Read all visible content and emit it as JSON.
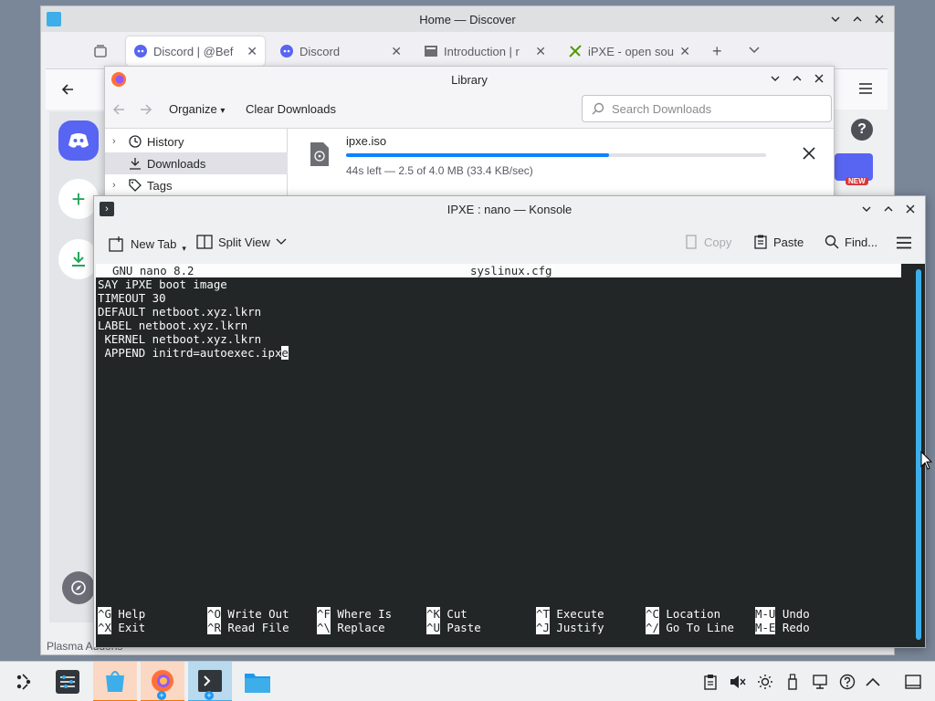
{
  "discover": {
    "title": "Home — Discover",
    "footer_label": "Plasma Addons"
  },
  "firefox": {
    "tabs": [
      {
        "label": "Discord | @Bef"
      },
      {
        "label": "Discord"
      },
      {
        "label": "Introduction | r"
      },
      {
        "label": "iPXE - open sou"
      }
    ]
  },
  "library": {
    "title": "Library",
    "organize_label": "Organize",
    "clear_downloads_label": "Clear Downloads",
    "search_placeholder": "Search Downloads",
    "sidebar": [
      {
        "label": "History"
      },
      {
        "label": "Downloads"
      },
      {
        "label": "Tags"
      }
    ],
    "download": {
      "filename": "ipxe.iso",
      "status": "44s left — 2.5 of 4.0 MB (33.4 KB/sec)",
      "progress": 0.625
    }
  },
  "konsole": {
    "title": "IPXE : nano — Konsole",
    "toolbar": {
      "new_tab": "New Tab",
      "split_view": "Split View",
      "copy": "Copy",
      "paste": "Paste",
      "find": "Find..."
    }
  },
  "nano": {
    "version": "GNU nano 8.2",
    "filename": "syslinux.cfg",
    "lines": [
      "SAY iPXE boot image",
      "TIMEOUT 30",
      "DEFAULT netboot.xyz.lkrn",
      "LABEL netboot.xyz.lkrn",
      " KERNEL netboot.xyz.lkrn"
    ],
    "last_line_before_cursor": " APPEND initrd=autoexec.ipx",
    "cursor_char": "e",
    "shortcuts": [
      {
        "k1": "^G",
        "l1": "Help",
        "k2": "^X",
        "l2": "Exit"
      },
      {
        "k1": "^O",
        "l1": "Write Out",
        "k2": "^R",
        "l2": "Read File"
      },
      {
        "k1": "^F",
        "l1": "Where Is",
        "k2": "^\\",
        "l2": "Replace"
      },
      {
        "k1": "^K",
        "l1": "Cut",
        "k2": "^U",
        "l2": "Paste"
      },
      {
        "k1": "^T",
        "l1": "Execute",
        "k2": "^J",
        "l2": "Justify"
      },
      {
        "k1": "^C",
        "l1": "Location",
        "k2": "^/",
        "l2": "Go To Line"
      },
      {
        "k1": "M-U",
        "l1": "Undo",
        "k2": "M-E",
        "l2": "Redo"
      }
    ]
  },
  "discord": {
    "badge_new": "NEW"
  },
  "colors": {
    "accent": "#3daee9",
    "terminal_bg": "#232627",
    "firefox_progress": "#0a84ff",
    "discord_blurple": "#5865f2"
  }
}
